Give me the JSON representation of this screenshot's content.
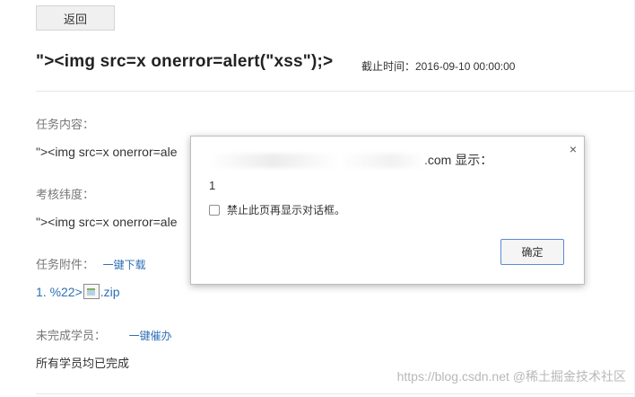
{
  "header": {
    "back_label": "返回",
    "title": "\"><img src=x onerror=alert(\"xss\");>",
    "deadline": "截止时间：2016-09-10 00:00:00"
  },
  "task_content": {
    "label": "任务内容：",
    "value": "\"><img src=x onerror=ale"
  },
  "assessment": {
    "label": "考核纬度：",
    "value": "\"><img src=x onerror=ale"
  },
  "attachments": {
    "label": "任务附件：",
    "download_all": "一键下载",
    "file_prefix": "1. %22>",
    "file_suffix": ".zip"
  },
  "incomplete": {
    "label": "未完成学员：",
    "urge_all": "一键催办",
    "status": "所有学员均已完成"
  },
  "dialog": {
    "title_suffix": ".com 显示：",
    "message": "1",
    "checkbox_label": "禁止此页再显示对话框。",
    "ok_label": "确定",
    "close_glyph": "×"
  },
  "watermark": "https://blog.csdn.net @稀土掘金技术社区"
}
